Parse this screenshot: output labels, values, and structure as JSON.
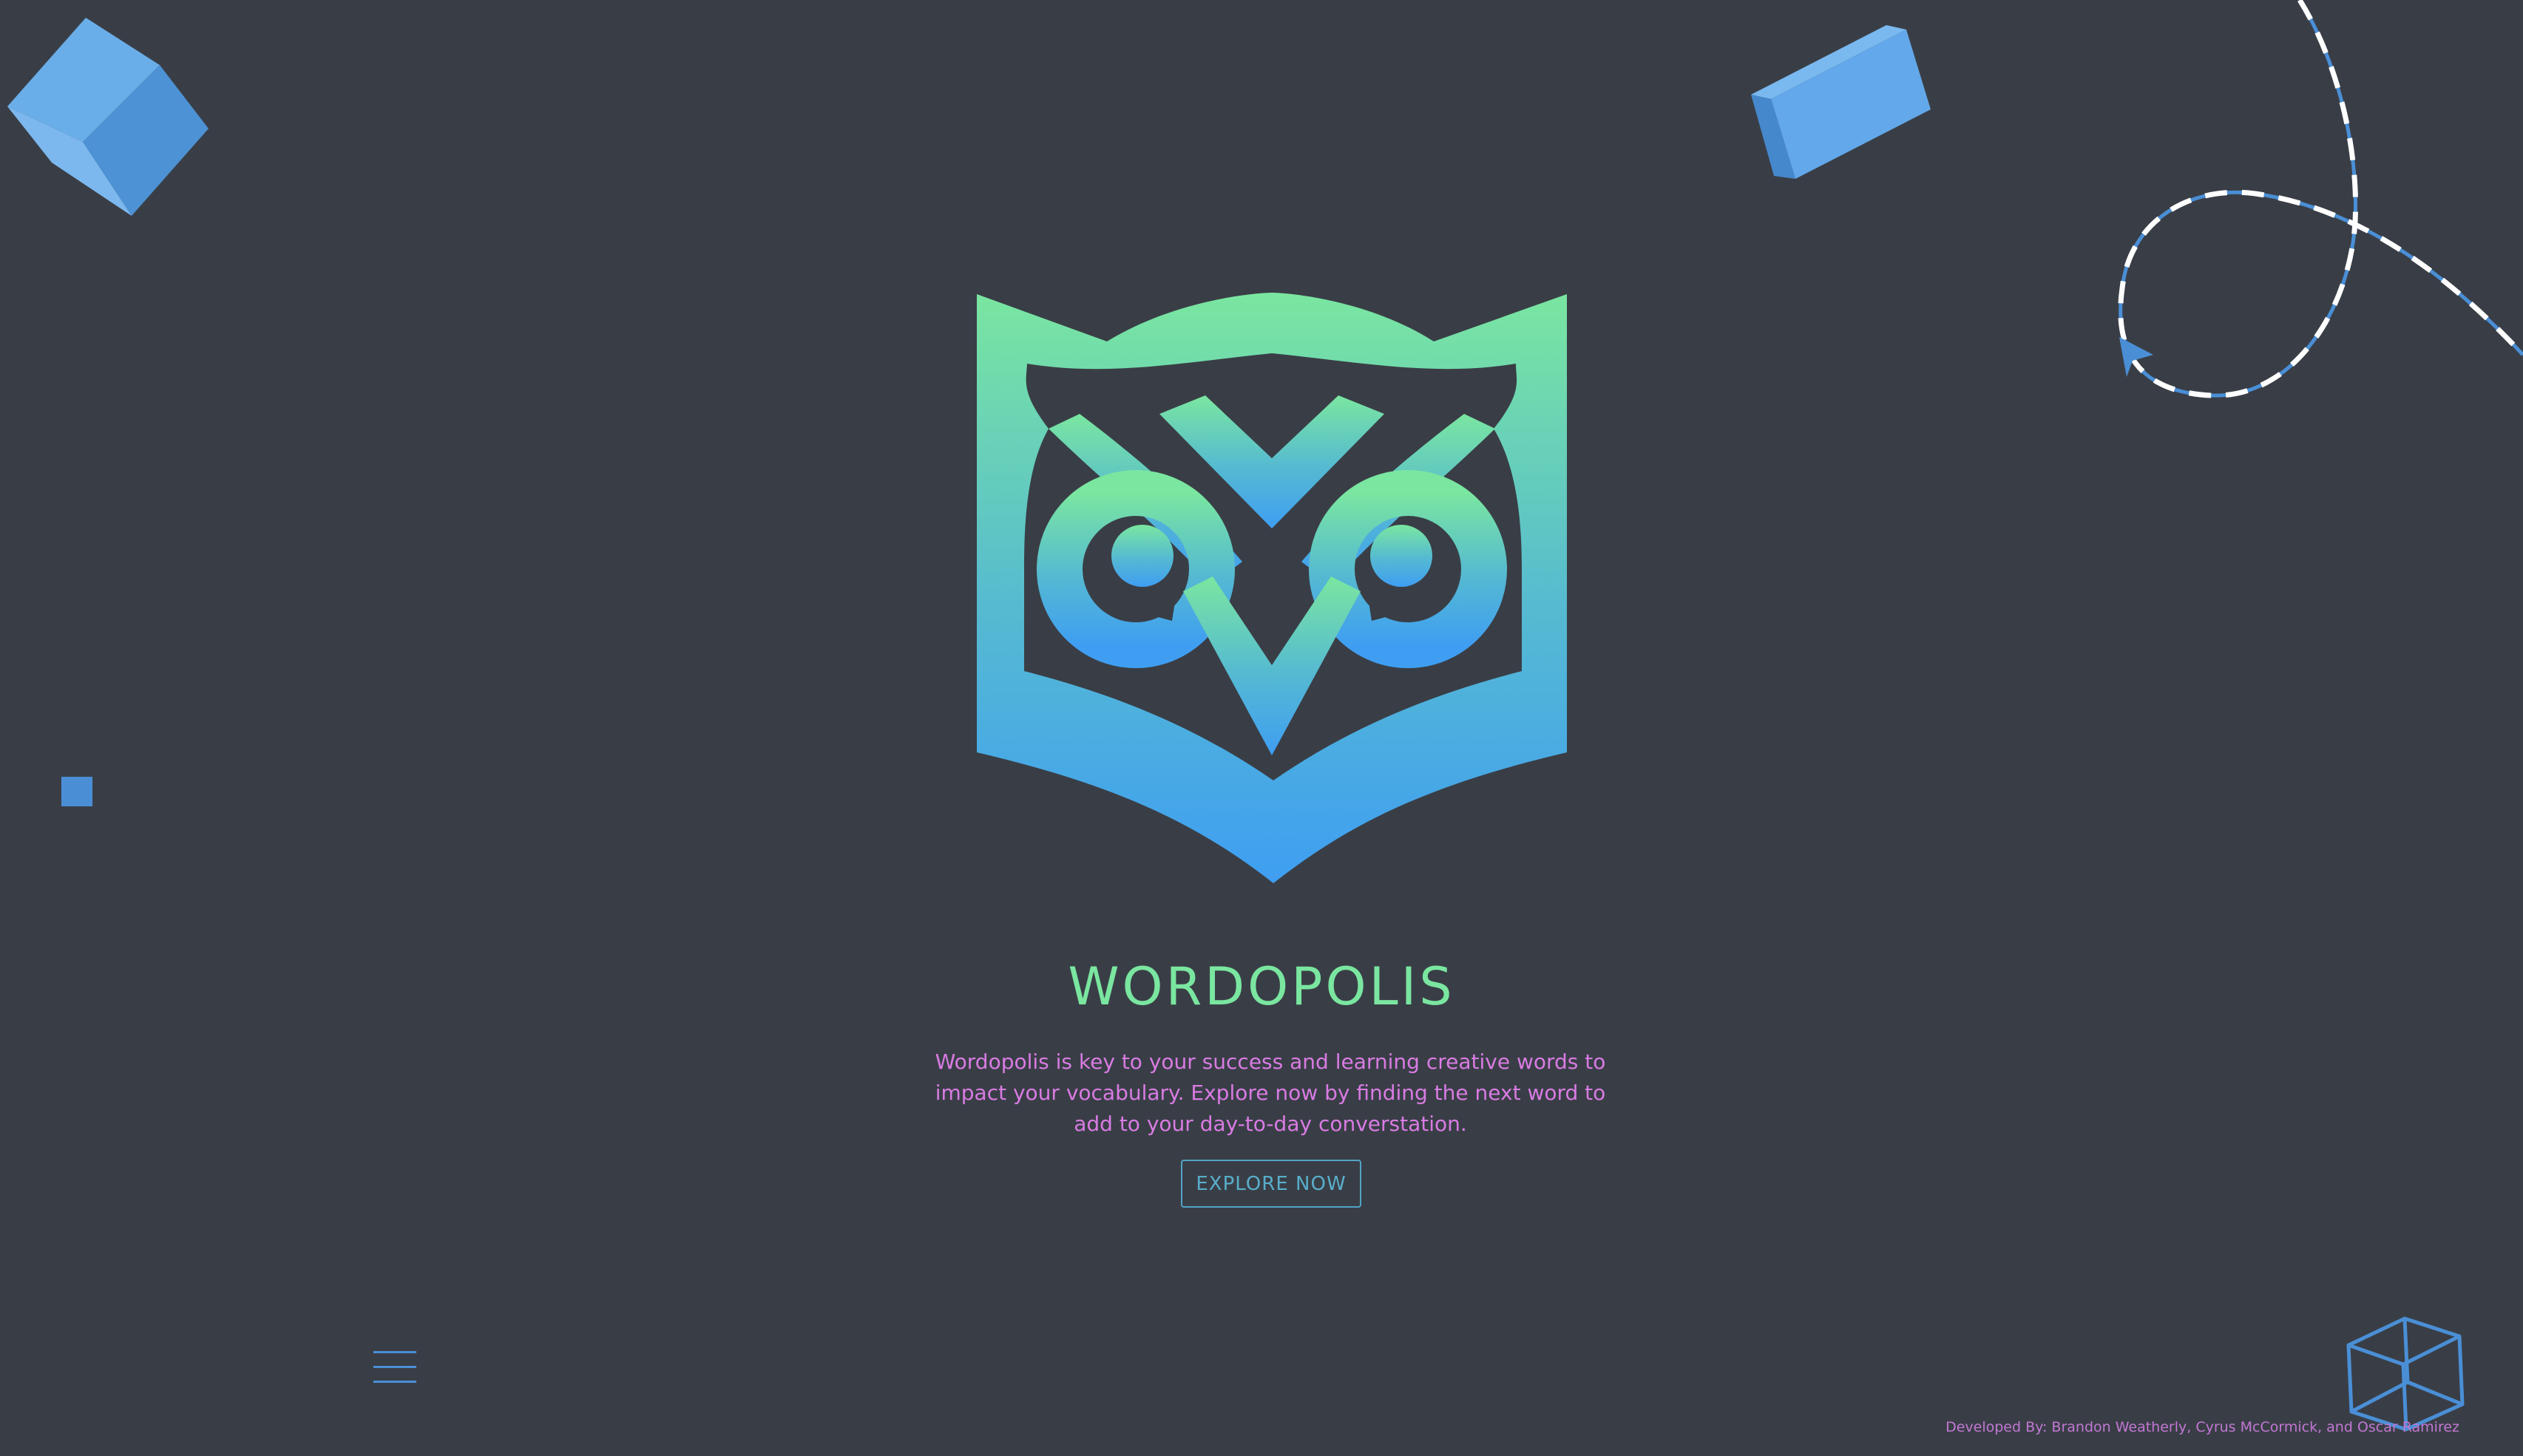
{
  "app": {
    "title": "WORDOPOLIS",
    "tagline": "Wordopolis is key to your success and learning creative words to impact your vocabulary. Explore now by finding the next word to add to your day-to-day converstation.",
    "cta_label": "EXPLORE NOW",
    "credits": "Developed By: Brandon Weatherly, Cyrus McCormick, and Oscar Ramirez"
  },
  "logo": {
    "icon": "owl-logo-icon",
    "gradient": [
      "#7ae6a0",
      "#3f9ef2"
    ]
  },
  "menu": {
    "icon": "hamburger-menu-icon"
  },
  "decorations": [
    "cube-icon",
    "block-icon",
    "square-icon",
    "dashed-loop-arrow-icon",
    "wireframe-cube-icon"
  ],
  "colors": {
    "background": "#393e46",
    "title": "#7ae6a0",
    "tagline": "#d97be3",
    "accent_blue": "#4a8fd6",
    "button_border": "#53a4c6"
  }
}
